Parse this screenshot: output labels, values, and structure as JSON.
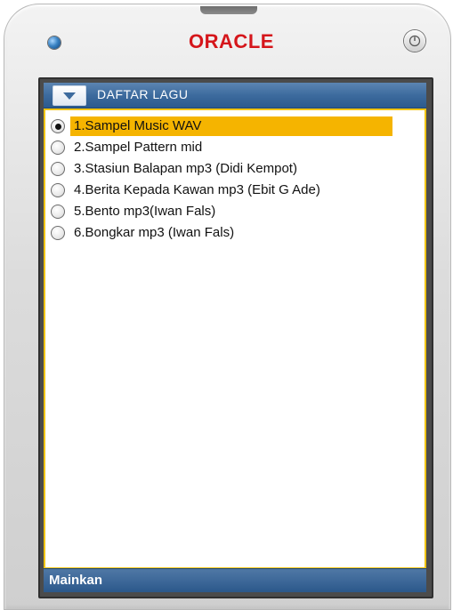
{
  "device": {
    "brand": "ORACLE",
    "led_color": "#3b84c4",
    "brand_color": "#d5161b",
    "power_icon": "power-icon"
  },
  "screen": {
    "title": "DAFTAR LAGU",
    "menu_icon": "chevron-down-icon",
    "accent": "#3d6b9e",
    "highlight": "#f5b400",
    "songs": [
      {
        "label": "1.Sampel Music WAV",
        "selected": true
      },
      {
        "label": "2.Sampel Pattern mid",
        "selected": false
      },
      {
        "label": "3.Stasiun Balapan mp3 (Didi Kempot)",
        "selected": false
      },
      {
        "label": "4.Berita Kepada Kawan mp3 (Ebit G Ade)",
        "selected": false
      },
      {
        "label": "5.Bento mp3(Iwan Fals)",
        "selected": false
      },
      {
        "label": "6.Bongkar mp3 (Iwan Fals)",
        "selected": false
      }
    ],
    "softkey_left": "Mainkan"
  }
}
